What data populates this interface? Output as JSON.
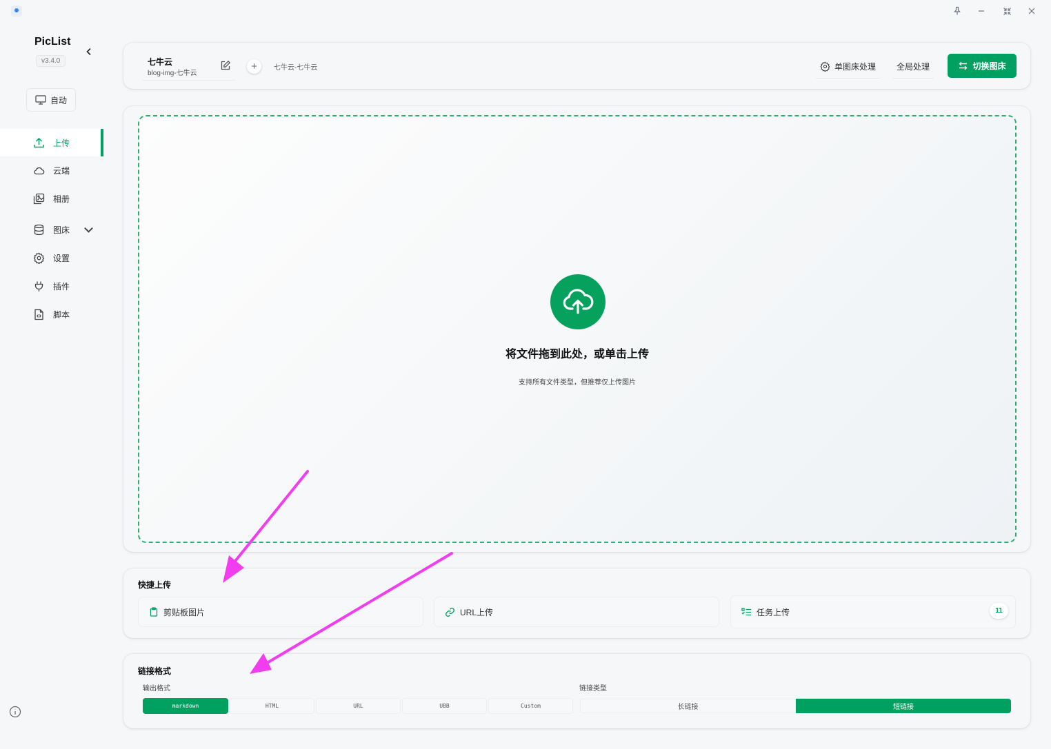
{
  "sidebar": {
    "brand": "PicList",
    "version": "v3.4.0",
    "auto_label": "自动",
    "items": [
      {
        "label": "上传",
        "icon": "upload-icon",
        "active": true
      },
      {
        "label": "云端",
        "icon": "cloud-icon"
      },
      {
        "label": "相册",
        "icon": "gallery-icon"
      },
      {
        "label": "图床",
        "icon": "database-icon",
        "expandable": true
      },
      {
        "label": "设置",
        "icon": "gear-icon"
      },
      {
        "label": "插件",
        "icon": "plug-icon"
      },
      {
        "label": "脚本",
        "icon": "script-icon"
      }
    ]
  },
  "header": {
    "pic_bed_name": "七牛云",
    "pic_bed_config": "blog-img-七牛云",
    "config_tag": "七牛云-七牛云",
    "single_process": "单图床处理",
    "global_process": "全局处理",
    "switch_button": "切换图床"
  },
  "dropzone": {
    "title": "将文件拖到此处，或单击上传",
    "subtitle": "支持所有文件类型，但推荐仅上传图片"
  },
  "quick_upload": {
    "title": "快捷上传",
    "clipboard": "剪贴板图片",
    "url": "URL上传",
    "task": "任务上传",
    "task_count": "11"
  },
  "link_format": {
    "title": "链接格式",
    "output_label": "输出格式",
    "formats": [
      "markdown",
      "HTML",
      "URL",
      "UBB",
      "Custom"
    ],
    "selected_format": "markdown",
    "link_type_label": "链接类型",
    "link_types": [
      "长链接",
      "短链接"
    ],
    "selected_link_type": "短链接"
  },
  "colors": {
    "accent": "#00a160",
    "annotation_arrow": "#f23cf0"
  }
}
